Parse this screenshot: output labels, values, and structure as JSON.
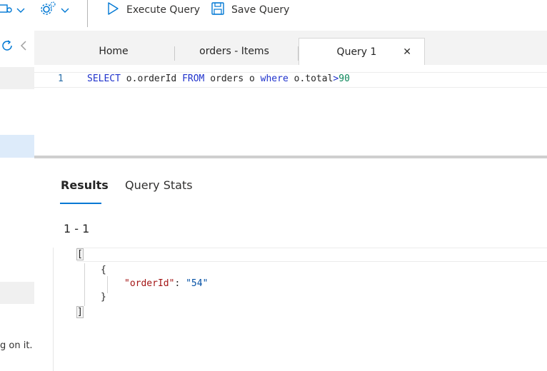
{
  "toolbar": {
    "execute_label": "Execute Query",
    "save_label": "Save Query",
    "icons": [
      "new-container-icon",
      "settings-gear-icon",
      "play-icon",
      "save-icon"
    ]
  },
  "left_panel": {
    "truncated_text": "g on it.",
    "icons": [
      "refresh-icon",
      "collapse-chevron-icon"
    ]
  },
  "tabs": [
    {
      "label": "Home",
      "active": false
    },
    {
      "label": "orders - Items",
      "active": false
    },
    {
      "label": "Query 1",
      "active": true,
      "close_glyph": "✕"
    }
  ],
  "editor": {
    "line_number": "1",
    "tokens": [
      {
        "text": "SELECT",
        "kind": "keyword"
      },
      {
        "text": " o.orderId ",
        "kind": "plain"
      },
      {
        "text": "FROM",
        "kind": "keyword"
      },
      {
        "text": " orders o ",
        "kind": "plain"
      },
      {
        "text": "where",
        "kind": "keyword"
      },
      {
        "text": " o.total",
        "kind": "plain"
      },
      {
        "text": ">",
        "kind": "keyword"
      },
      {
        "text": "90",
        "kind": "number"
      }
    ]
  },
  "results": {
    "tabs": [
      {
        "label": "Results",
        "active": true
      },
      {
        "label": "Query Stats",
        "active": false
      }
    ],
    "range": "1 - 1",
    "json": {
      "open_array": "[",
      "open_obj": "{",
      "key": "\"orderId\"",
      "colon": ": ",
      "value": "\"54\"",
      "close_obj": "}",
      "close_array": "]"
    }
  },
  "colors": {
    "accent": "#0078d4",
    "keyword": "#2033cc",
    "number": "#098658",
    "json_key": "#a31515",
    "json_value": "#0451a5",
    "selected_row": "#ddebfa"
  }
}
